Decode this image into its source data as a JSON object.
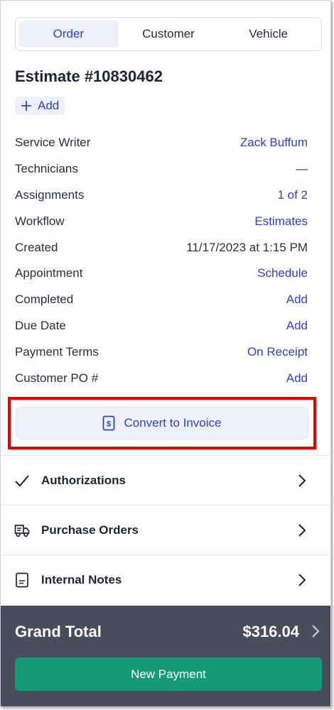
{
  "tabs": [
    {
      "label": "Order",
      "active": true
    },
    {
      "label": "Customer",
      "active": false
    },
    {
      "label": "Vehicle",
      "active": false
    }
  ],
  "estimate": {
    "title": "Estimate #10830462",
    "add_label": "Add"
  },
  "details": [
    {
      "label": "Service Writer",
      "value": "Zack Buffum",
      "link": true
    },
    {
      "label": "Technicians",
      "value": "—",
      "link": false
    },
    {
      "label": "Assignments",
      "value": "1 of 2",
      "link": true
    },
    {
      "label": "Workflow",
      "value": "Estimates",
      "link": true
    },
    {
      "label": "Created",
      "value": "11/17/2023 at 1:15 PM",
      "link": false
    },
    {
      "label": "Appointment",
      "value": "Schedule",
      "link": true
    },
    {
      "label": "Completed",
      "value": "Add",
      "link": true
    },
    {
      "label": "Due Date",
      "value": "Add",
      "link": true
    },
    {
      "label": "Payment Terms",
      "value": "On Receipt",
      "link": true
    },
    {
      "label": "Customer PO #",
      "value": "Add",
      "link": true
    }
  ],
  "convert_label": "Convert to Invoice",
  "sections": [
    {
      "label": "Authorizations",
      "icon": "checkmark-icon"
    },
    {
      "label": "Purchase Orders",
      "icon": "truck-icon"
    },
    {
      "label": "Internal Notes",
      "icon": "note-icon"
    }
  ],
  "footer": {
    "grand_total_label": "Grand Total",
    "grand_total_value": "$316.04",
    "new_payment_label": "New Payment"
  },
  "colors": {
    "accent": "#2f3fce",
    "accent_bg": "#eef0fb",
    "highlight": "#e60000",
    "footer_bg": "#4a4c5c",
    "payment_green": "#159a78"
  }
}
